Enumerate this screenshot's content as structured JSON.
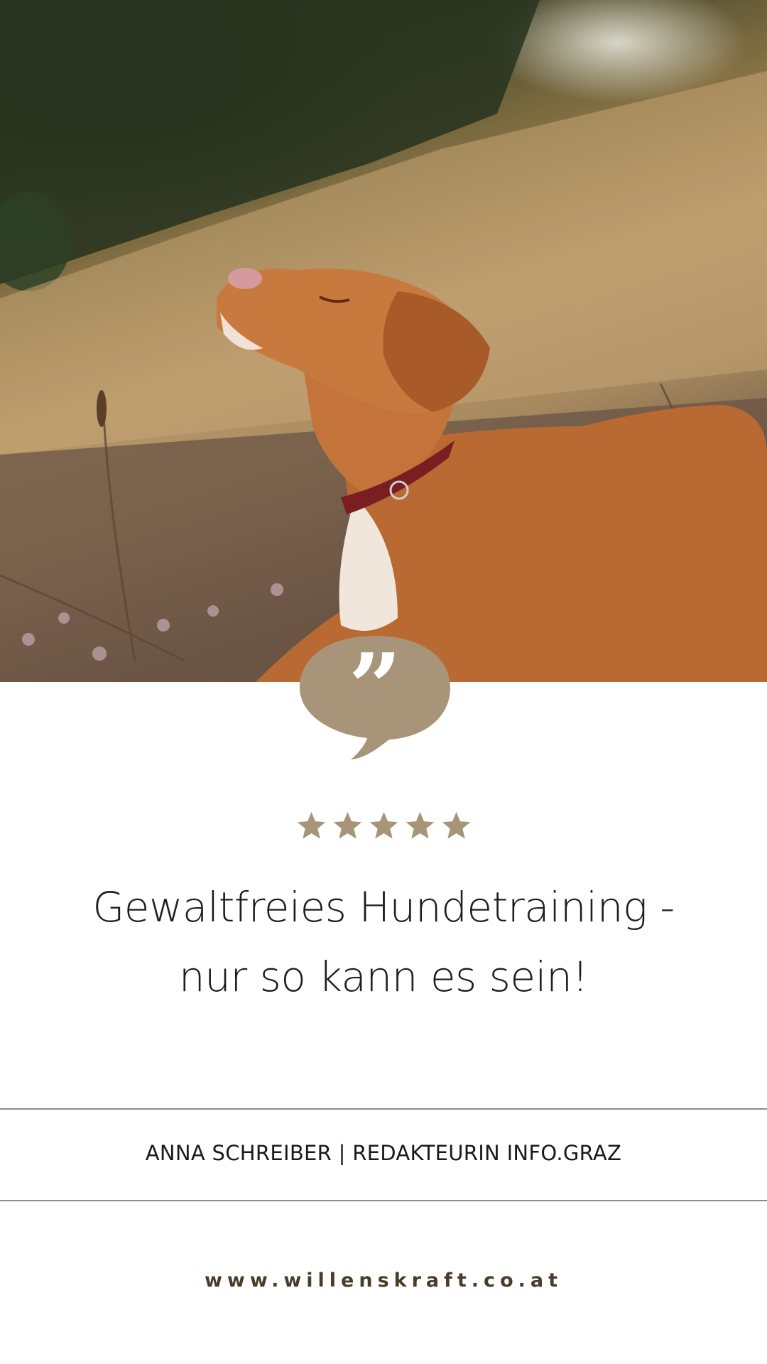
{
  "card": {
    "rating": 5,
    "accent_color": "#a89478",
    "title_line1": "Gewaltfreies Hundetraining -",
    "title_line2": "nur so kann es sein!",
    "author": "ANNA SCHREIBER | REDAKTEURIN INFO.GRAZ",
    "website": "www.willenskraft.co.at"
  },
  "icons": {
    "quote": "quote-bubble-icon",
    "star": "star-icon"
  }
}
